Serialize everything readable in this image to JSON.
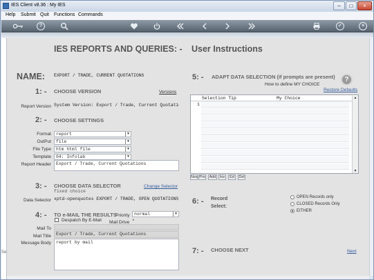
{
  "window": {
    "title": "IES Client v8.36 : My IES",
    "minimize": "–",
    "maximize": "□",
    "close": "×"
  },
  "menu": [
    "Help",
    "Submit",
    "Quit",
    "Functions",
    "Commands"
  ],
  "toolbar": {
    "icons": [
      "key-icon",
      "help-icon",
      "search-icon",
      "heart-icon",
      "power-icon",
      "rewind-icon",
      "back-icon",
      "forward-icon",
      "fast-forward-icon",
      "print-icon",
      "confirm-icon",
      "cancel-icon"
    ],
    "help": "?",
    "confirm": "✓",
    "cancel": "×"
  },
  "sidebar_label": "Se",
  "page": {
    "heading": "IES REPORTS AND QUERIES: -",
    "heading2": "User Instructions",
    "name_label": "NAME:",
    "name_value": "EXPORT / TRADE, CURRENT QUOTATIONS"
  },
  "section1": {
    "num": "1: -",
    "title": "CHOOSE VERSION",
    "link": "Versions",
    "report_version_label": "Report Version",
    "report_version_value": "System Version: Export / Trade, Current Quotations"
  },
  "section2": {
    "num": "2: -",
    "title": "CHOOSE SETTINGS",
    "format_label": "Format",
    "format_value": "report",
    "output_label": "OutPut",
    "output_value": "file",
    "filetype_label": "File Type",
    "filetype_value": "htm html file",
    "template_label": "Template",
    "template_value": "04: Infolab",
    "header_label": "Report Header",
    "header_value": "Export / Trade, Current Quotations"
  },
  "section3": {
    "num": "3: -",
    "title": "CHOOSE DATA SELECTOR",
    "link": "Change Selector",
    "selector_type": "fixed choice",
    "selector_label": "Data Selector",
    "selector_value": "xptd-openquotes EXPORT / TRADE, OPEN QUOTATIONS"
  },
  "section4": {
    "num": "4: -",
    "title": "TO e-MAIL THE RESULTS",
    "priority_label": "Priority",
    "priority_value": "normal",
    "despatch_label": "Despatch By E-Mail",
    "maildrive_label": "Mail Drive",
    "maildrive_value": "*",
    "mailto_label": "Mail To",
    "mailto_value": "",
    "mailtitle_label": "Mail Title",
    "mailtitle_value": "Export / Trade, Current Quotations",
    "mailbody_label": "Message Body",
    "mailbody_value": "report by mail"
  },
  "section5": {
    "num": "5: -",
    "title": "ADAPT DATA SELECTION (if prompts are present)",
    "help_link": "How to define MY CHOICE",
    "help_icon_text": "?",
    "restore_link": "Restore Defaults",
    "columns": [
      "Selection Tip",
      "My Choice"
    ],
    "first_row": "1",
    "buttons": [
      "Nex",
      "Pre",
      "Add",
      "Ins",
      "Ed",
      "Del"
    ]
  },
  "section6": {
    "num": "6: -",
    "title": "Record",
    "subtitle": "Select:",
    "options": [
      "OPEN Records only",
      "CLOSED Records Only",
      "EITHER"
    ],
    "selected": "EITHER"
  },
  "section7": {
    "num": "7: -",
    "title": "CHOOSE NEXT",
    "link": "Next"
  }
}
